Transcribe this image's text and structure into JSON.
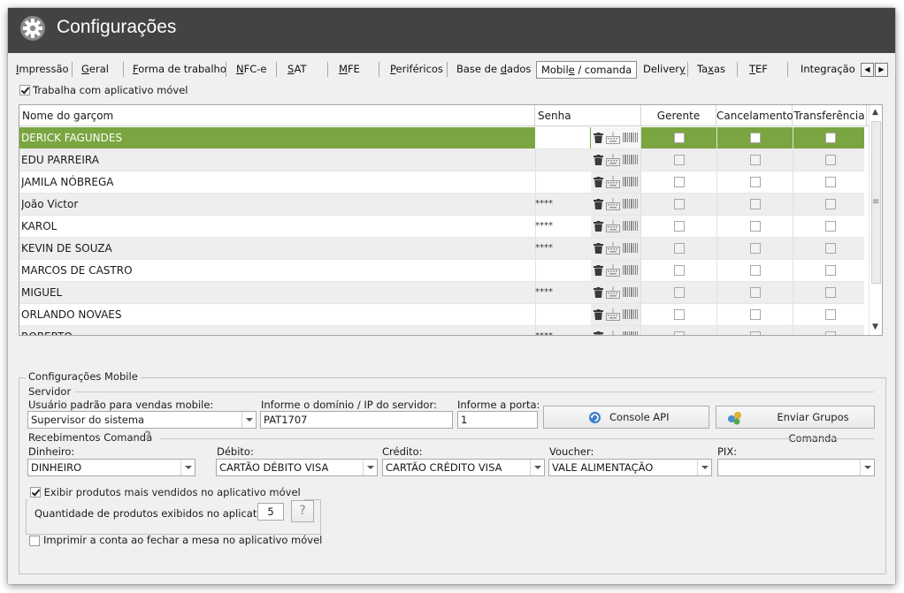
{
  "window": {
    "title": "Configurações"
  },
  "tabs": [
    {
      "pre": "",
      "u": "I",
      "post": "mpressão"
    },
    {
      "pre": "",
      "u": "G",
      "post": "eral"
    },
    {
      "pre": "",
      "u": "F",
      "post": "orma de trabalho"
    },
    {
      "pre": "",
      "u": "N",
      "post": "FC-e"
    },
    {
      "pre": "",
      "u": "S",
      "post": "AT"
    },
    {
      "pre": "",
      "u": "M",
      "post": "FE"
    },
    {
      "pre": "",
      "u": "P",
      "post": "eriféricos"
    },
    {
      "pre": "Base de ",
      "u": "d",
      "post": "ados"
    },
    {
      "pre": "Mobil",
      "u": "e",
      "post": " / comanda"
    },
    {
      "pre": "Deliver",
      "u": "y",
      "post": ""
    },
    {
      "pre": "Ta",
      "u": "x",
      "post": "as"
    },
    {
      "pre": "",
      "u": "T",
      "post": "EF"
    },
    {
      "pre": "Integração",
      "u": "",
      "post": ""
    }
  ],
  "tab_scroll": {
    "left": "◀",
    "right": "▶"
  },
  "mobile_app": {
    "label": "Trabalha com aplicativo móvel",
    "checked": true
  },
  "grid": {
    "columns": {
      "name": "Nome do garçom",
      "password": "Senha",
      "manager": "Gerente",
      "cancel": "Cancelamento",
      "transfer": "Transferência"
    },
    "rows": [
      {
        "name": "DERICK FAGUNDES",
        "password": ""
      },
      {
        "name": "EDU PARREIRA",
        "password": ""
      },
      {
        "name": "JAMILA NÓBREGA",
        "password": ""
      },
      {
        "name": "João Victor",
        "password": "****"
      },
      {
        "name": "KAROL",
        "password": "****"
      },
      {
        "name": "KEVIN DE SOUZA",
        "password": "****"
      },
      {
        "name": "MARCOS DE CASTRO",
        "password": ""
      },
      {
        "name": "MIGUEL",
        "password": "****"
      },
      {
        "name": "ORLANDO NOVAES",
        "password": ""
      },
      {
        "name": "ROBERTO",
        "password": "****"
      }
    ],
    "selected_index": 0,
    "row_icons": [
      "trash-icon",
      "keyboard-icon",
      "barcode-icon"
    ]
  },
  "mobile_config": {
    "title": "Configurações Mobile",
    "server": {
      "title": "Servidor",
      "default_user_label": "Usuário padrão para vendas mobile:",
      "default_user_value": "Supervisor do sistema",
      "domain_label": "Informe o domínio / IP do servidor:",
      "domain_value": "PAT1707",
      "port_label": "Informe a porta:",
      "port_value": "1",
      "console_button": "Console API",
      "send_groups_button": "Enviar Grupos Comanda"
    },
    "receipts": {
      "title": "Recebimentos Comanda",
      "help": "?",
      "cash_label": "Dinheiro:",
      "cash_value": "DINHEIRO",
      "debit_label": "Débito:",
      "debit_value": "CARTÃO DÉBITO VISA",
      "credit_label": "Crédito:",
      "credit_value": "CARTÃO CRÉDITO VISA",
      "voucher_label": "Voucher:",
      "voucher_value": "VALE ALIMENTAÇÃO",
      "pix_label": "PIX:",
      "pix_value": ""
    },
    "best_sellers": {
      "label": "Exibir produtos mais vendidos no aplicativo móvel",
      "checked": true,
      "quantity_label": "Quantidade de produtos exibidos no aplicativo:",
      "quantity_value": "5",
      "help": "?"
    },
    "print_on_close": {
      "label": "Imprimir a conta ao fechar a mesa no aplicativo móvel",
      "checked": false
    }
  },
  "colors": {
    "titlebar": "#434343",
    "selected_row": "#7aa540",
    "window_bg": "#f0f0f0"
  }
}
